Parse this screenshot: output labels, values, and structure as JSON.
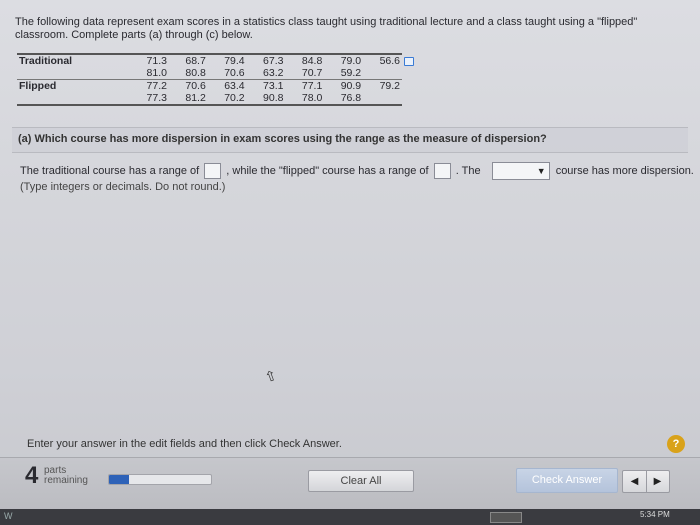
{
  "intro": {
    "text": "The following data represent exam scores in a statistics class taught using traditional lecture and a class taught using a \"flipped\" classroom. Complete parts (a) through (c) below."
  },
  "data_table": {
    "rows": [
      {
        "label": "Traditional",
        "values": [
          "71.3",
          "68.7",
          "79.4",
          "67.3",
          "84.8",
          "79.0",
          "56.6"
        ]
      },
      {
        "label": "",
        "values": [
          "81.0",
          "80.8",
          "70.6",
          "63.2",
          "70.7",
          "59.2",
          ""
        ]
      },
      {
        "label": "Flipped",
        "values": [
          "77.2",
          "70.6",
          "63.4",
          "73.1",
          "77.1",
          "90.9",
          "79.2"
        ]
      },
      {
        "label": "",
        "values": [
          "77.3",
          "81.2",
          "70.2",
          "90.8",
          "78.0",
          "76.8",
          ""
        ]
      }
    ]
  },
  "question": {
    "text": "(a) Which course has more dispersion in exam scores using the range as the measure of dispersion?"
  },
  "answer": {
    "part1": "The traditional course has a range of",
    "range_traditional_value": "",
    "part2": ", while the \"flipped\" course has a range of",
    "range_flipped_value": "",
    "part3": ". The",
    "course_select_value": "",
    "part4": "course has more dispersion.",
    "hint": "(Type integers or decimals. Do not round.)"
  },
  "instruction": "Enter your answer in the edit fields and then click Check Answer.",
  "help_label": "?",
  "footer": {
    "parts_count": "4",
    "parts_label_1": "parts",
    "parts_label_2": "remaining",
    "progress_fraction": 0.2,
    "clear_all_label": "Clear All",
    "check_answer_label": "Check Answer",
    "prev_label": "◀",
    "next_label": "▶"
  },
  "taskbar": {
    "left_label": "W",
    "time": "5:34 PM"
  },
  "colors": {
    "progress_fill": "#2e62b8",
    "help_button": "#d9a21a",
    "check_button": "#b4c3db"
  }
}
